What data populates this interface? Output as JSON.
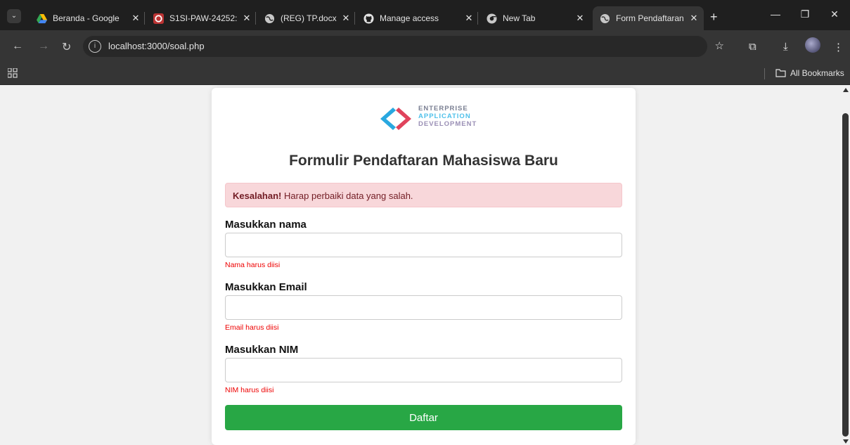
{
  "browser": {
    "tabs": [
      {
        "title": "Beranda - Google",
        "icon": "google-drive-icon"
      },
      {
        "title": "S1SI-PAW-24252: ",
        "icon": "course-icon"
      },
      {
        "title": "(REG) TP.docx",
        "icon": "globe-icon"
      },
      {
        "title": "Manage access",
        "icon": "github-icon"
      },
      {
        "title": "New Tab",
        "icon": "chrome-icon"
      },
      {
        "title": "Form Pendaftaran",
        "icon": "globe-icon",
        "active": true
      }
    ],
    "url": "localhost:3000/soal.php",
    "bookmarks_label": "All Bookmarks"
  },
  "logo": {
    "line1": "ENTERPRISE",
    "line2": "APPLICATION",
    "line3": "DEVELOPMENT"
  },
  "form": {
    "title": "Formulir Pendaftaran Mahasiswa Baru",
    "alert_strong": "Kesalahan!",
    "alert_text": " Harap perbaiki data yang salah.",
    "fields": [
      {
        "label": "Masukkan nama",
        "value": "",
        "error": "Nama harus diisi"
      },
      {
        "label": "Masukkan Email",
        "value": "",
        "error": "Email harus diisi"
      },
      {
        "label": "Masukkan NIM",
        "value": "",
        "error": "NIM harus diisi"
      }
    ],
    "submit_label": "Daftar"
  },
  "colors": {
    "alert_bg": "#f8d7da",
    "alert_text": "#721c24",
    "error_text": "#ee0000",
    "submit_bg": "#28a745"
  }
}
